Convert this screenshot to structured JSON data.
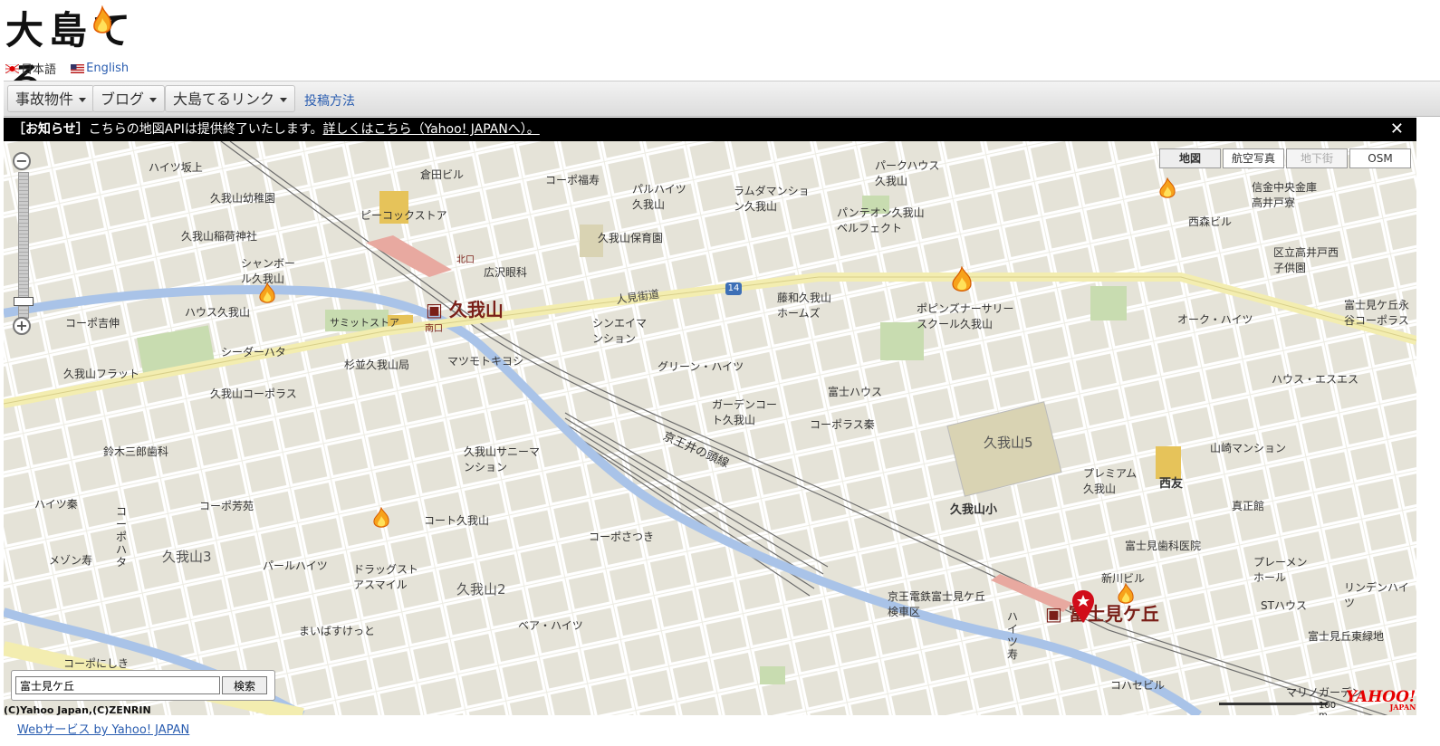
{
  "site": {
    "logo_text": "大島てる",
    "logo_icon": "flame-icon"
  },
  "languages": [
    {
      "label": "日本語",
      "icon": "japan-flag-icon"
    },
    {
      "label": "English",
      "icon": "us-flag-icon"
    }
  ],
  "nav": {
    "menu1": "事故物件",
    "menu2": "ブログ",
    "menu3": "大島てるリンク",
    "link": "投稿方法"
  },
  "notice": {
    "label": "［お知らせ］",
    "text": "こちらの地図APIは提供終了いたします。",
    "link": "詳しくはこちら（Yahoo! JAPANへ）。",
    "close": "✕"
  },
  "map": {
    "types": {
      "map": "地図",
      "aerial": "航空写真",
      "underground": "地下街",
      "osm": "OSM"
    },
    "stations": [
      "久我山",
      "富士見ケ丘"
    ],
    "railway": "京王井の頭線",
    "road": "人見街道",
    "route_no": "14",
    "districts": [
      "久我山5",
      "久我山3",
      "久我山2"
    ],
    "school": "久我山小",
    "store": "西友",
    "station_exits": [
      "北口",
      "南口"
    ],
    "labels": [
      "ハイツ坂上",
      "倉田ビル",
      "コーポ福寿",
      "パルハイツ久我山",
      "ラムダマンション久我山",
      "パークハウス久我山",
      "パンテオン久我山ベルフェクト",
      "久我山幼稚園",
      "ピーコックストア",
      "久我山稲荷神社",
      "久我山保育園",
      "シャンボール久我山",
      "広沢眼科",
      "ハウス久我山",
      "サミットストア",
      "コーポ吉伸",
      "シーダーハタ",
      "杉並久我山局",
      "マツモトキヨシ",
      "シンエイマンション",
      "藤和久我山ホームズ",
      "ポピンズナーサリースクール久我山",
      "久我山フラット",
      "久我山コーポラス",
      "グリーン・ハイツ",
      "ガーデンコート久我山",
      "富士ハウス",
      "コーポラス秦",
      "鈴木三郎歯科",
      "久我山サニーマンション",
      "ハイツ秦",
      "コーポ芳苑",
      "コーポハタ",
      "コート久我山",
      "メゾン寿",
      "コーポさつき",
      "パールハイツ",
      "ドラッグストアスマイル",
      "まいばすけっと",
      "ベア・ハイツ",
      "コーポにしき",
      "京王電鉄富士見ケ丘検車区",
      "信金中央金庫高井戸寮",
      "西森ビル",
      "区立高井戸西子供園",
      "富士見ケ丘永谷コーポラス",
      "オーク・ハイツ",
      "ハウス・エスエス",
      "山崎マンション",
      "プレミアム久我山",
      "真正館",
      "富士見歯科医院",
      "新川ビル",
      "プレーメンホール",
      "STハウス",
      "リンデンハイツ",
      "富士見丘東緑地",
      "コハセビル",
      "マリノガーデン",
      "ハイツ寿"
    ]
  },
  "search": {
    "value": "富士見ケ丘",
    "button": "検索"
  },
  "copyright": "(C)Yahoo Japan,(C)ZENRIN",
  "scale": "100 m",
  "yahoo_logo": "YAHOO!",
  "yahoo_sub": "JAPAN",
  "webservice": "Webサービス by Yahoo! JAPAN"
}
